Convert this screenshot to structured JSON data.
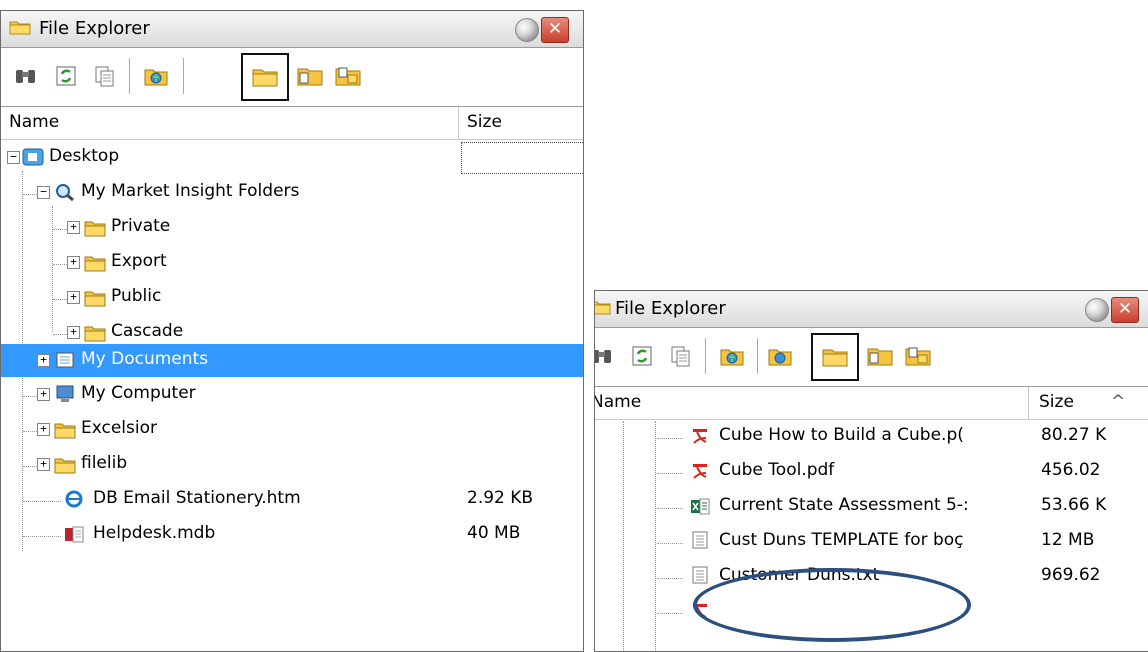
{
  "window1": {
    "title": "File Explorer",
    "close_label": "✕",
    "columns": {
      "name": "Name",
      "size": "Size"
    },
    "tree": [
      {
        "label": "Desktop",
        "size": "",
        "icon": "desktop-icon",
        "expander": "−"
      },
      {
        "label": "My Market Insight Folders",
        "size": "",
        "icon": "magnifier-folder-icon",
        "expander": "−"
      },
      {
        "label": "Private",
        "size": "",
        "icon": "folder-icon",
        "expander": "+"
      },
      {
        "label": "Export",
        "size": "",
        "icon": "folder-icon",
        "expander": "+"
      },
      {
        "label": "Public",
        "size": "",
        "icon": "folder-icon",
        "expander": "+"
      },
      {
        "label": "Cascade",
        "size": "",
        "icon": "folder-icon",
        "expander": "+"
      },
      {
        "label": "My Documents",
        "size": "",
        "icon": "documents-icon",
        "expander": "+",
        "selected": true
      },
      {
        "label": "My Computer",
        "size": "",
        "icon": "computer-icon",
        "expander": "+"
      },
      {
        "label": "Excelsior",
        "size": "",
        "icon": "folder-icon",
        "expander": "+"
      },
      {
        "label": "filelib",
        "size": "",
        "icon": "folder-icon",
        "expander": "+"
      },
      {
        "label": "DB Email Stationery.htm",
        "size": "2.92 KB",
        "icon": "ie-htm-icon"
      },
      {
        "label": "Helpdesk.mdb",
        "size": "40 MB",
        "icon": "access-mdb-icon"
      }
    ]
  },
  "window2": {
    "title": "File Explorer",
    "close_label": "✕",
    "columns": {
      "name": "Name",
      "size": "Size"
    },
    "scroll_up": "^",
    "files": [
      {
        "label": "Cube How to Build a Cube.p(",
        "size": "80.27 K",
        "icon": "pdf-icon"
      },
      {
        "label": "Cube Tool.pdf",
        "size": "456.02",
        "icon": "pdf-icon"
      },
      {
        "label": "Current State Assessment 5-:",
        "size": "53.66 K",
        "icon": "excel-icon"
      },
      {
        "label": "Cust Duns TEMPLATE for boç",
        "size": "12 MB",
        "icon": "text-file-icon"
      },
      {
        "label": "Customer Duns.txt",
        "size": "969.62",
        "icon": "text-file-icon",
        "circled": true
      },
      {
        "label": "",
        "size": "",
        "icon": "pdf-icon"
      }
    ]
  },
  "colors": {
    "selection": "#3399ff",
    "annotation_oval": "#2b4f7e",
    "close": "#c9402d",
    "folder": "#f5c542"
  }
}
